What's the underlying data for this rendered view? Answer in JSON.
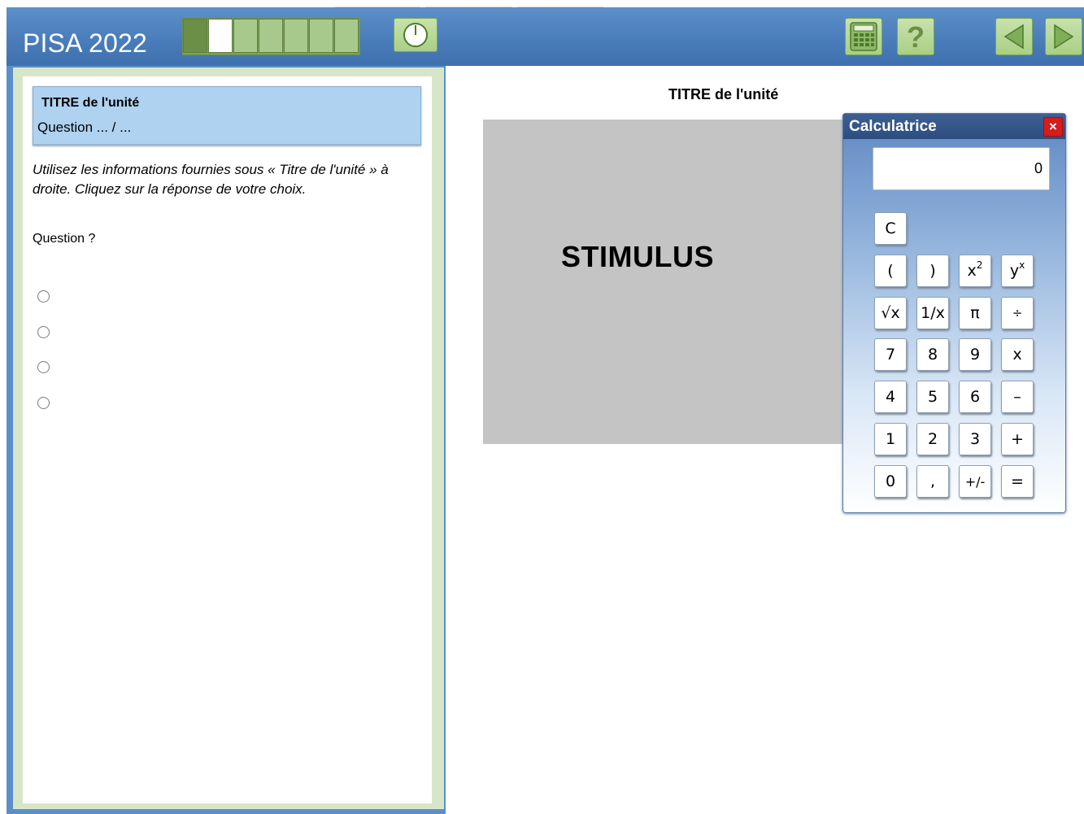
{
  "header": {
    "app_title": "PISA 2022",
    "progress": {
      "total": 7,
      "done": 1,
      "current": 2
    },
    "buttons": [
      {
        "name": "timer-button",
        "icon": "clock-icon"
      },
      {
        "name": "calculator-button",
        "icon": "calculator-icon"
      },
      {
        "name": "help-button",
        "icon": "question-icon"
      },
      {
        "name": "previous-button",
        "icon": "arrow-left-icon"
      },
      {
        "name": "next-button",
        "icon": "arrow-right-icon"
      }
    ],
    "accent_color": "#a9cf86",
    "bar_color": "#4a7dbb"
  },
  "question_panel": {
    "unit_title": "TITRE de l'unité",
    "question_counter": "Question ... / ...",
    "instruction": "Utilisez les informations fournies sous « Titre de l'unité » à droite. Cliquez sur la réponse de votre choix.",
    "question": "Question ?",
    "options": [
      "",
      "",
      "",
      ""
    ]
  },
  "stimulus": {
    "title": "TITRE de l'unité",
    "label": "STIMULUS"
  },
  "calculator": {
    "title": "Calculatrice",
    "close": "×",
    "display": "0",
    "keys": {
      "clear": "C",
      "open_paren": "(",
      "close_paren": ")",
      "square": "x",
      "square_exp": "2",
      "power": "y",
      "power_exp": "x",
      "sqrt": "√x",
      "reciprocal": "1/x",
      "pi": "π",
      "divide": "÷",
      "seven": "7",
      "eight": "8",
      "nine": "9",
      "multiply": "x",
      "four": "4",
      "five": "5",
      "six": "6",
      "minus": "–",
      "one": "1",
      "two": "2",
      "three": "3",
      "plus": "+",
      "zero": "0",
      "comma": ",",
      "sign": "+/-",
      "equals": "="
    }
  }
}
